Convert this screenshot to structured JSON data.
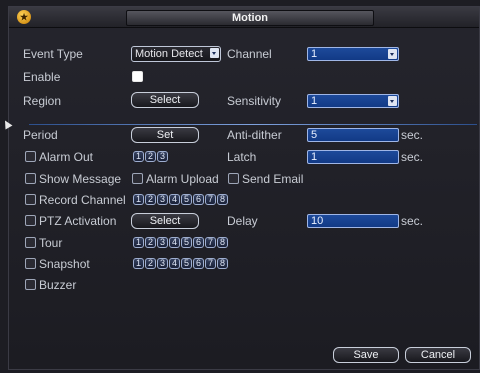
{
  "window": {
    "title": "Motion"
  },
  "labels": {
    "event_type": "Event Type",
    "channel": "Channel",
    "enable": "Enable",
    "region": "Region",
    "sensitivity": "Sensitivity",
    "period": "Period",
    "anti_dither": "Anti-dither",
    "alarm_out": "Alarm Out",
    "latch": "Latch",
    "show_message": "Show Message",
    "alarm_upload": "Alarm Upload",
    "send_email": "Send Email",
    "record_channel": "Record Channel",
    "ptz_activation": "PTZ Activation",
    "delay": "Delay",
    "tour": "Tour",
    "snapshot": "Snapshot",
    "buzzer": "Buzzer",
    "sec": "sec."
  },
  "values": {
    "event_type": "Motion Detect",
    "channel": "1",
    "sensitivity": "1",
    "anti_dither": "5",
    "latch": "1",
    "delay": "10"
  },
  "buttons": {
    "region_select": "Select",
    "period_set": "Set",
    "ptz_select": "Select",
    "save": "Save",
    "cancel": "Cancel"
  },
  "alarm_out_channels": [
    "1",
    "2",
    "3"
  ],
  "record_channels": [
    "1",
    "2",
    "3",
    "4",
    "5",
    "6",
    "7",
    "8"
  ],
  "tour_channels": [
    "1",
    "2",
    "3",
    "4",
    "5",
    "6",
    "7",
    "8"
  ],
  "snapshot_channels": [
    "1",
    "2",
    "3",
    "4",
    "5",
    "6",
    "7",
    "8"
  ],
  "icons": {
    "app": "dvr-logo-icon"
  }
}
